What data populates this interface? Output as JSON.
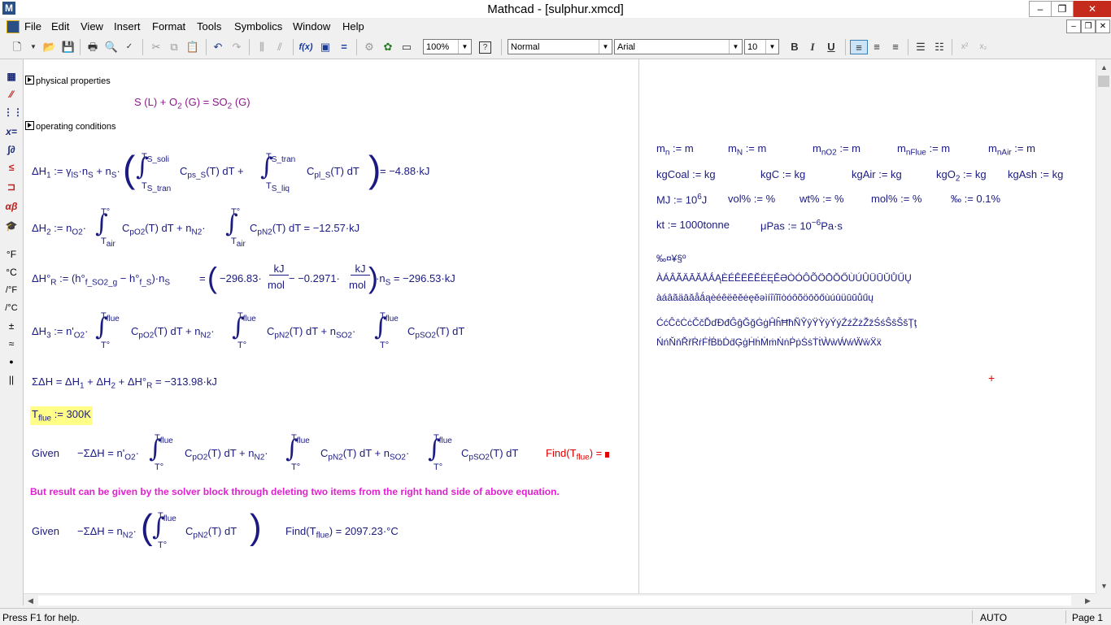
{
  "window": {
    "title": "Mathcad - [sulphur.xmcd]",
    "minimize": "–",
    "maximize": "❐",
    "close": "✕"
  },
  "menu": {
    "items": [
      "File",
      "Edit",
      "View",
      "Insert",
      "Format",
      "Tools",
      "Symbolics",
      "Window",
      "Help"
    ]
  },
  "toolbar": {
    "zoom": "100%",
    "style": "Normal",
    "font": "Arial",
    "size": "10",
    "bold": "B",
    "italic": "I",
    "underline": "U"
  },
  "palette": {
    "units": [
      "°F",
      "°C",
      "/°F",
      "/°C",
      "±",
      "≈",
      "●",
      "||"
    ]
  },
  "worksheet": {
    "heading_physical": "physical properties",
    "reaction": "S (L) + O",
    "reaction_sub": "2",
    "reaction_rest": " (G) = SO",
    "reaction_sub2": "2",
    "reaction_end": " (G)",
    "heading_operating": "operating conditions",
    "dh1_lhs": "ΔH",
    "dh1_sub": "1",
    "dh1_a": " := γ",
    "dh1_a_sub": "lS",
    "dh1_b": "·n",
    "dh1_b_sub": "S",
    "dh1_c": " + n",
    "dh1_c_sub": "S",
    "dh1_upper1": "T",
    "dh1_upper1_sub": "S_soli",
    "dh1_lower1": "T",
    "dh1_lower1_sub": "S_tran",
    "dh1_f1": "C",
    "dh1_f1_sub": "ps_S",
    "dh1_f1_rest": "(T) dT +",
    "dh1_upper2": "T",
    "dh1_upper2_sub": "S_tran",
    "dh1_lower2": "T",
    "dh1_lower2_sub": "S_liq",
    "dh1_f2": "C",
    "dh1_f2_sub": "pl_S",
    "dh1_f2_rest": "(T) dT",
    "dh1_result": "= −4.88·kJ",
    "dh2_lhs": "ΔH",
    "dh2_sub": "2",
    "dh2_a": " := n",
    "dh2_a_sub": "O2",
    "dh2_upper": "T°",
    "dh2_lower": "T",
    "dh2_lower_sub": "air",
    "dh2_f1": "C",
    "dh2_f1_sub": "pO2",
    "dh2_f1_rest": "(T) dT + n",
    "dh2_n2": "N2",
    "dh2_f2": "C",
    "dh2_f2_sub": "pN2",
    "dh2_f2_rest": "(T) dT = −12.57·kJ",
    "dhr_lhs": "ΔH°",
    "dhr_sub": "R",
    "dhr_a": " := (h°",
    "dhr_a_sub": "f_SO2_g",
    "dhr_b": " − h°",
    "dhr_b_sub": "f_S",
    "dhr_c": ")·n",
    "dhr_c_sub": "S",
    "dhr_eq": "=",
    "dhr_v1": "−296.83·",
    "dhr_kj": "kJ",
    "dhr_mol": "mol",
    "dhr_v2": " − −0.2971·",
    "dhr_d": "·n",
    "dhr_d_sub": "S",
    "dhr_result": " = −296.53·kJ",
    "dh3_lhs": "ΔH",
    "dh3_sub": "3",
    "dh3_a": " := n'",
    "dh3_a_sub": "O2",
    "dh3_upper": "T",
    "dh3_upper_sub": "flue",
    "dh3_lower": "T°",
    "dh3_f1": "C",
    "dh3_f1_sub": "pO2",
    "dh3_f1_rest": "(T) dT + n",
    "dh3_n2": "N2",
    "dh3_f2": "C",
    "dh3_f2_sub": "pN2",
    "dh3_f2_rest": "(T) dT + n",
    "dh3_so2": "SO2",
    "dh3_f3": "C",
    "dh3_f3_sub": "pSO2",
    "dh3_f3_rest": "(T) dT",
    "sum_text": "ΣΔH = ΔH",
    "sum_s1": "1",
    "sum_p1": " + ΔH",
    "sum_s2": "2",
    "sum_p2": " + ΔH°",
    "sum_s3": "R",
    "sum_result": " = −313.98·kJ",
    "tflue_def": "T",
    "tflue_sub": "flue",
    "tflue_val": " := 300K",
    "given1": "Given",
    "given1_eq": "−ΣΔH = n'",
    "given1_eq_sub": "O2",
    "given1_rest": "(T) dT + n",
    "given1_so2_rest": "(T) dT",
    "find1": "Find(T",
    "find1_sub": "flue",
    "find1_rest": ") = ",
    "note": "But result can be given by the solver block  through deleting two items from the right hand side of above equation.",
    "given2": "Given",
    "given2_eq": "−ΣΔH = n",
    "given2_eq_sub": "N2",
    "given2_f": "C",
    "given2_f_sub": "pN2",
    "given2_f_rest": "(T) dT",
    "find2": "Find(T",
    "find2_sub": "flue",
    "find2_rest": ") = 2097.23·°C",
    "defs_row1": [
      {
        "a": "m",
        "s": "n",
        "b": " := m"
      },
      {
        "a": "m",
        "s": "N",
        "b": " := m"
      },
      {
        "a": "m",
        "s": "nO2",
        "b": " := m"
      },
      {
        "a": "m",
        "s": "nFlue",
        "b": " := m"
      },
      {
        "a": "m",
        "s": "nAir",
        "b": " := m"
      }
    ],
    "defs_row2": [
      {
        "a": "kgCoal",
        "s": "",
        "b": " := kg"
      },
      {
        "a": "kgC",
        "s": "",
        "b": " := kg"
      },
      {
        "a": "kgAir",
        "s": "",
        "b": " := kg"
      },
      {
        "a": "kgO",
        "s": "2",
        "b": " := kg"
      },
      {
        "a": "kgAsh",
        "s": "",
        "b": " := kg"
      }
    ],
    "defs_row3_mj": "MJ := 10",
    "defs_row3_mj_sup": "6",
    "defs_row3_mj_end": "J",
    "defs_row3": [
      "vol% := %",
      "wt% := %",
      "mol% := %",
      "‰ := 0.1%"
    ],
    "defs_row4_kt": "kt := 1000tonne",
    "defs_row4_pa": "μPas := 10",
    "defs_row4_pa_sup": "−6",
    "defs_row4_pa_end": "Pa·s",
    "chars1": "‰¤¥§º",
    "chars2": "ÀÁÂÃÄĀĂÅǺĄÈÉÊËĒĔĖĘĚƏÒÓÔÕÖŌŎŐÙÚÛÜŪŬŮŰŲ",
    "chars3": "àáâãäāăåǻąèéêëēĕėęěəìíîïĩīòóôõöōŏőùúûüūŭůűų",
    "chars4": "ĆćĈĉĊċČčĎďĐđĜĝĞğĠġĤĥĦħÑŶŷŸỲỳÝýŹźŻżŽžŚśŜŝŠšŢţ",
    "chars5": "ŃńŇňŘřṘṙḞḟḂḃḊḋĢģḢḣṀṁṄṅṖṗṠṡṪṫẀẁẂẃẄẅẌẍ"
  },
  "status": {
    "help": "Press F1 for help.",
    "mode": "AUTO",
    "page": "Page 1"
  }
}
